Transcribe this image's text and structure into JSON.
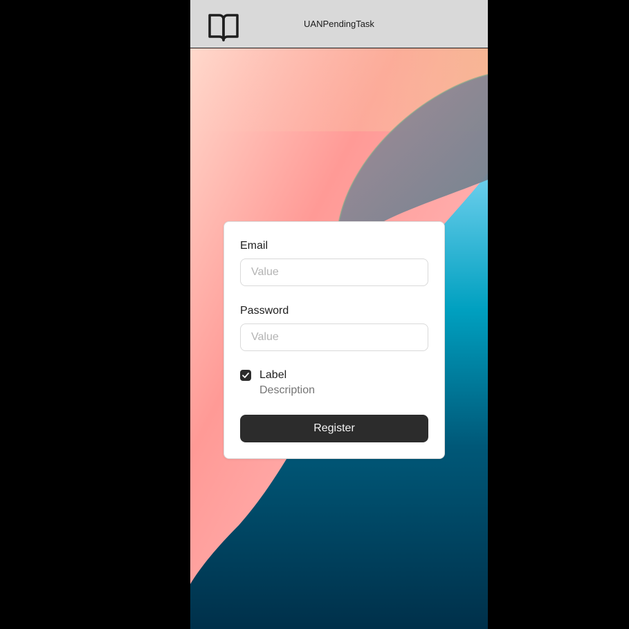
{
  "header": {
    "logo_icon": "open-book-icon",
    "title": "UANPendingTask"
  },
  "form": {
    "email": {
      "label": "Email",
      "placeholder": "Value"
    },
    "password": {
      "label": "Password",
      "placeholder": "Value"
    },
    "checkbox": {
      "checked": true,
      "label": "Label",
      "description": "Description"
    },
    "submit_label": "Register"
  },
  "colors": {
    "header_bg": "#d9d9d9",
    "button_bg": "#2c2c2c",
    "button_text": "#f5f5f5",
    "card_bg": "#ffffff",
    "placeholder": "#b3b3b3",
    "description": "#757575"
  }
}
